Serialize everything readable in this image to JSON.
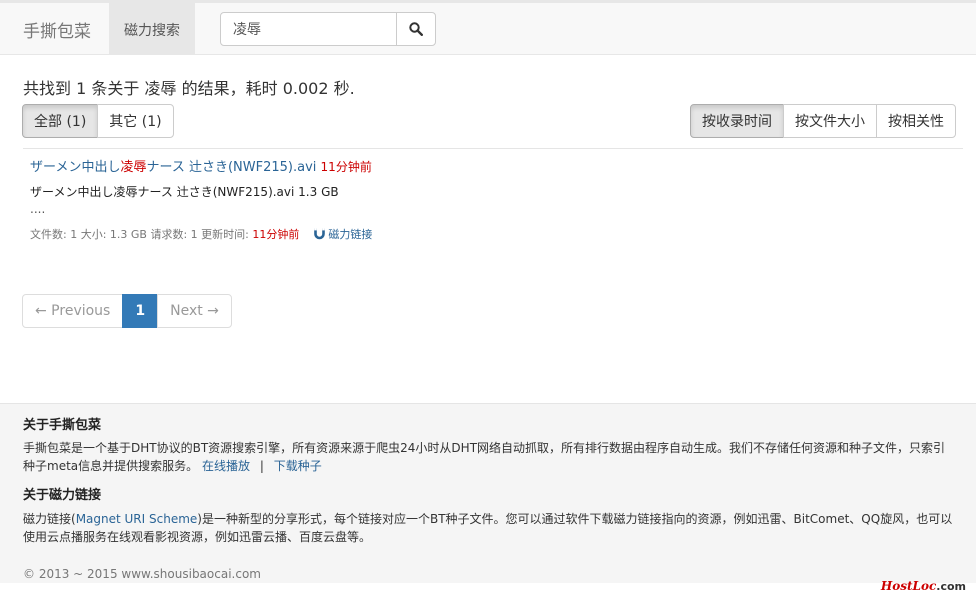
{
  "navbar": {
    "brand": "手撕包菜",
    "active_nav": "磁力搜索",
    "search": {
      "value": "凌辱",
      "placeholder": ""
    }
  },
  "summary": {
    "prefix": "共找到",
    "count": "1",
    "middle": "条关于",
    "keyword": "凌辱",
    "suffix": "的结果，耗时",
    "time": "0.002",
    "unit": "秒."
  },
  "filters": {
    "category": [
      {
        "label": "全部 (1)",
        "active": true
      },
      {
        "label": "其它 (1)",
        "active": false
      }
    ],
    "sort": [
      {
        "label": "按收录时间",
        "active": true
      },
      {
        "label": "按文件大小",
        "active": false
      },
      {
        "label": "按相关性",
        "active": false
      }
    ]
  },
  "results": [
    {
      "title_before": "ザーメン中出し",
      "title_highlight": "凌辱",
      "title_after": "ナース 辻さき(NWF215).avi",
      "ago": "11分钟前",
      "file_line": "ザーメン中出し凌辱ナース 辻さき(NWF215).avi 1.3 GB",
      "dots": "....",
      "meta_text": "文件数: 1 大小: 1.3 GB 请求数: 1 更新时间:",
      "meta_ago": "11分钟前",
      "magnet_label": "磁力链接"
    }
  ],
  "pagination": {
    "prev": "← Previous",
    "current": "1",
    "next": "Next →"
  },
  "footer": {
    "about_title": "关于手撕包菜",
    "about_text": "手撕包菜是一个基于DHT协议的BT资源搜索引擎，所有资源来源于爬虫24小时从DHT网络自动抓取，所有排行数据由程序自动生成。我们不存储任何资源和种子文件，只索引种子meta信息并提供搜索服务。",
    "online_play": "在线播放",
    "separator": "|",
    "download_seed": "下载种子",
    "magnet_title": "关于磁力链接",
    "magnet_text_before": "磁力链接(",
    "magnet_link": "Magnet URI Scheme",
    "magnet_text_after": ")是一种新型的分享形式，每个链接对应一个BT种子文件。您可以通过软件下载磁力链接指向的资源，例如迅雷、BitComet、QQ旋风，也可以使用云点播服务在线观看影视资源，例如迅雷云播、百度云盘等。",
    "copyright": "© 2013 ~ 2015 www.shousibaocai.com"
  },
  "watermark": {
    "brand": "HostLoc",
    "suffix": ".com"
  },
  "colors": {
    "link": "#2a6496",
    "highlight": "#cc0000",
    "primary": "#337ab7"
  }
}
